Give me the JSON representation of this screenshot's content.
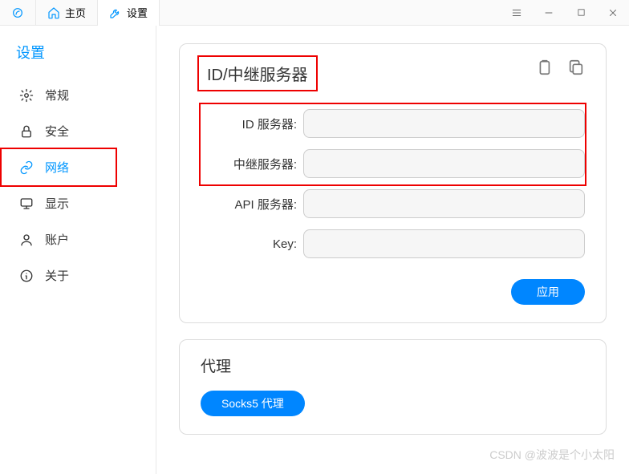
{
  "titlebar": {
    "tabs": [
      {
        "label": "主页"
      },
      {
        "label": "设置"
      }
    ]
  },
  "sidebar": {
    "title": "设置",
    "items": [
      {
        "label": "常规"
      },
      {
        "label": "安全"
      },
      {
        "label": "网络"
      },
      {
        "label": "显示"
      },
      {
        "label": "账户"
      },
      {
        "label": "关于"
      }
    ]
  },
  "card1": {
    "title": "ID/中继服务器",
    "fields": {
      "id_server": {
        "label": "ID 服务器:",
        "value": ""
      },
      "relay_server": {
        "label": "中继服务器:",
        "value": ""
      },
      "api_server": {
        "label": "API 服务器:",
        "value": ""
      },
      "key": {
        "label": "Key:",
        "value": ""
      }
    },
    "apply": "应用"
  },
  "card2": {
    "title": "代理",
    "socks5_btn": "Socks5 代理"
  },
  "watermark": "CSDN @波波是个小太阳"
}
